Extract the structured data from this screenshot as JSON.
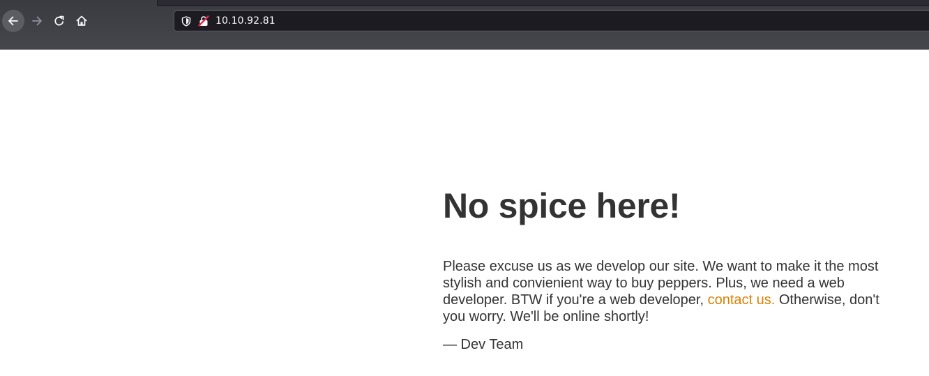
{
  "browser": {
    "url": "10.10.92.81",
    "icons": {
      "back": "arrow-left-icon",
      "forward": "arrow-right-icon",
      "reload": "reload-icon",
      "home": "home-icon",
      "tracking": "shield-icon",
      "security": "insecure-lock-icon"
    },
    "colors": {
      "chrome": "#3a3b40",
      "urlbar": "#1c1b22",
      "insecure": "#e22850"
    }
  },
  "page": {
    "heading": "No spice here!",
    "message": {
      "part1": "Please excuse us as we develop our site. We want to make it the most stylish and convienient way to buy peppers. Plus, we need a web developer. BTW if you're a web developer, ",
      "link": "contact us.",
      "part2": " Otherwise, don't you worry. We'll be online shortly!"
    },
    "signature": "— Dev Team",
    "colors": {
      "text": "#333333",
      "link": "#dc8100"
    }
  }
}
